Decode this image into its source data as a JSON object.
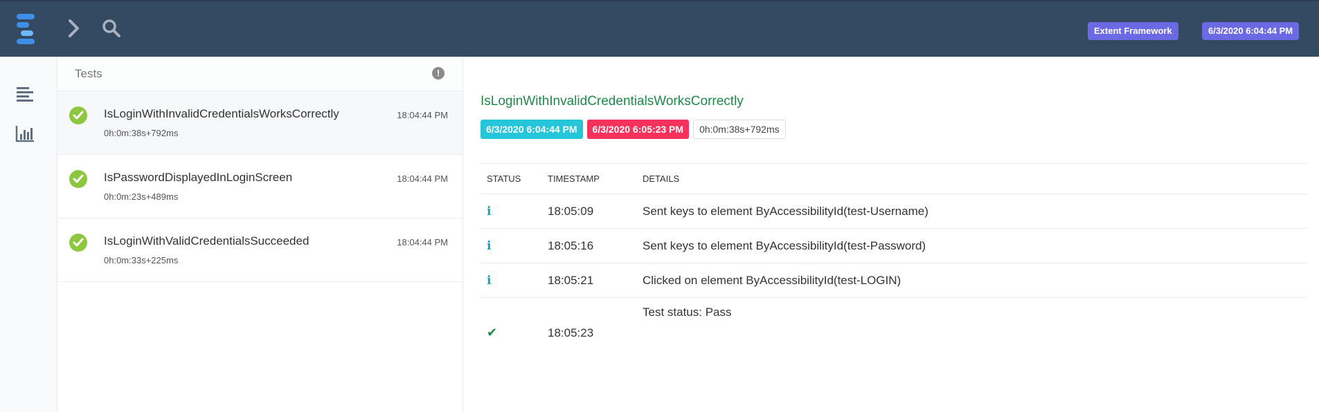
{
  "header": {
    "badges": [
      "Extent Framework",
      "6/3/2020 6:04:44 PM"
    ],
    "colors": {
      "background": "#344a63",
      "badge": "#6c69e4"
    }
  },
  "nav": {
    "icons": [
      "dashboard-list-icon",
      "chart-bar-icon"
    ]
  },
  "testlist": {
    "title": "Tests",
    "alert_symbol": "!",
    "items": [
      {
        "name": "IsLoginWithInvalidCredentialsWorksCorrectly",
        "duration": "0h:0m:38s+792ms",
        "time": "18:04:44 PM",
        "status": "pass"
      },
      {
        "name": "IsPasswordDisplayedInLoginScreen",
        "duration": "0h:0m:23s+489ms",
        "time": "18:04:44 PM",
        "status": "pass"
      },
      {
        "name": "IsLoginWithValidCredentialsSucceeded",
        "duration": "0h:0m:33s+225ms",
        "time": "18:04:44 PM",
        "status": "pass"
      }
    ]
  },
  "detail": {
    "title": "IsLoginWithInvalidCredentialsWorksCorrectly",
    "start": "6/3/2020 6:04:44 PM",
    "end": "6/3/2020 6:05:23 PM",
    "duration": "0h:0m:38s+792ms",
    "columns": {
      "status": "STATUS",
      "timestamp": "TIMESTAMP",
      "details": "DETAILS"
    },
    "logs": [
      {
        "status_icon": "i",
        "timestamp": "18:05:09",
        "details": "Sent keys to element ByAccessibilityId(test-Username)"
      },
      {
        "status_icon": "i",
        "timestamp": "18:05:16",
        "details": "Sent keys to element ByAccessibilityId(test-Password)"
      },
      {
        "status_icon": "i",
        "timestamp": "18:05:21",
        "details": "Clicked on element ByAccessibilityId(test-LOGIN)"
      },
      {
        "status_icon": "✔",
        "timestamp": "18:05:23",
        "details": "Test status: Pass"
      }
    ],
    "colors": {
      "title": "#1e8a4a",
      "start": "#26c6da",
      "end": "#f5325c",
      "info": "#17a2b8",
      "pass": "#1e8a4a"
    }
  }
}
